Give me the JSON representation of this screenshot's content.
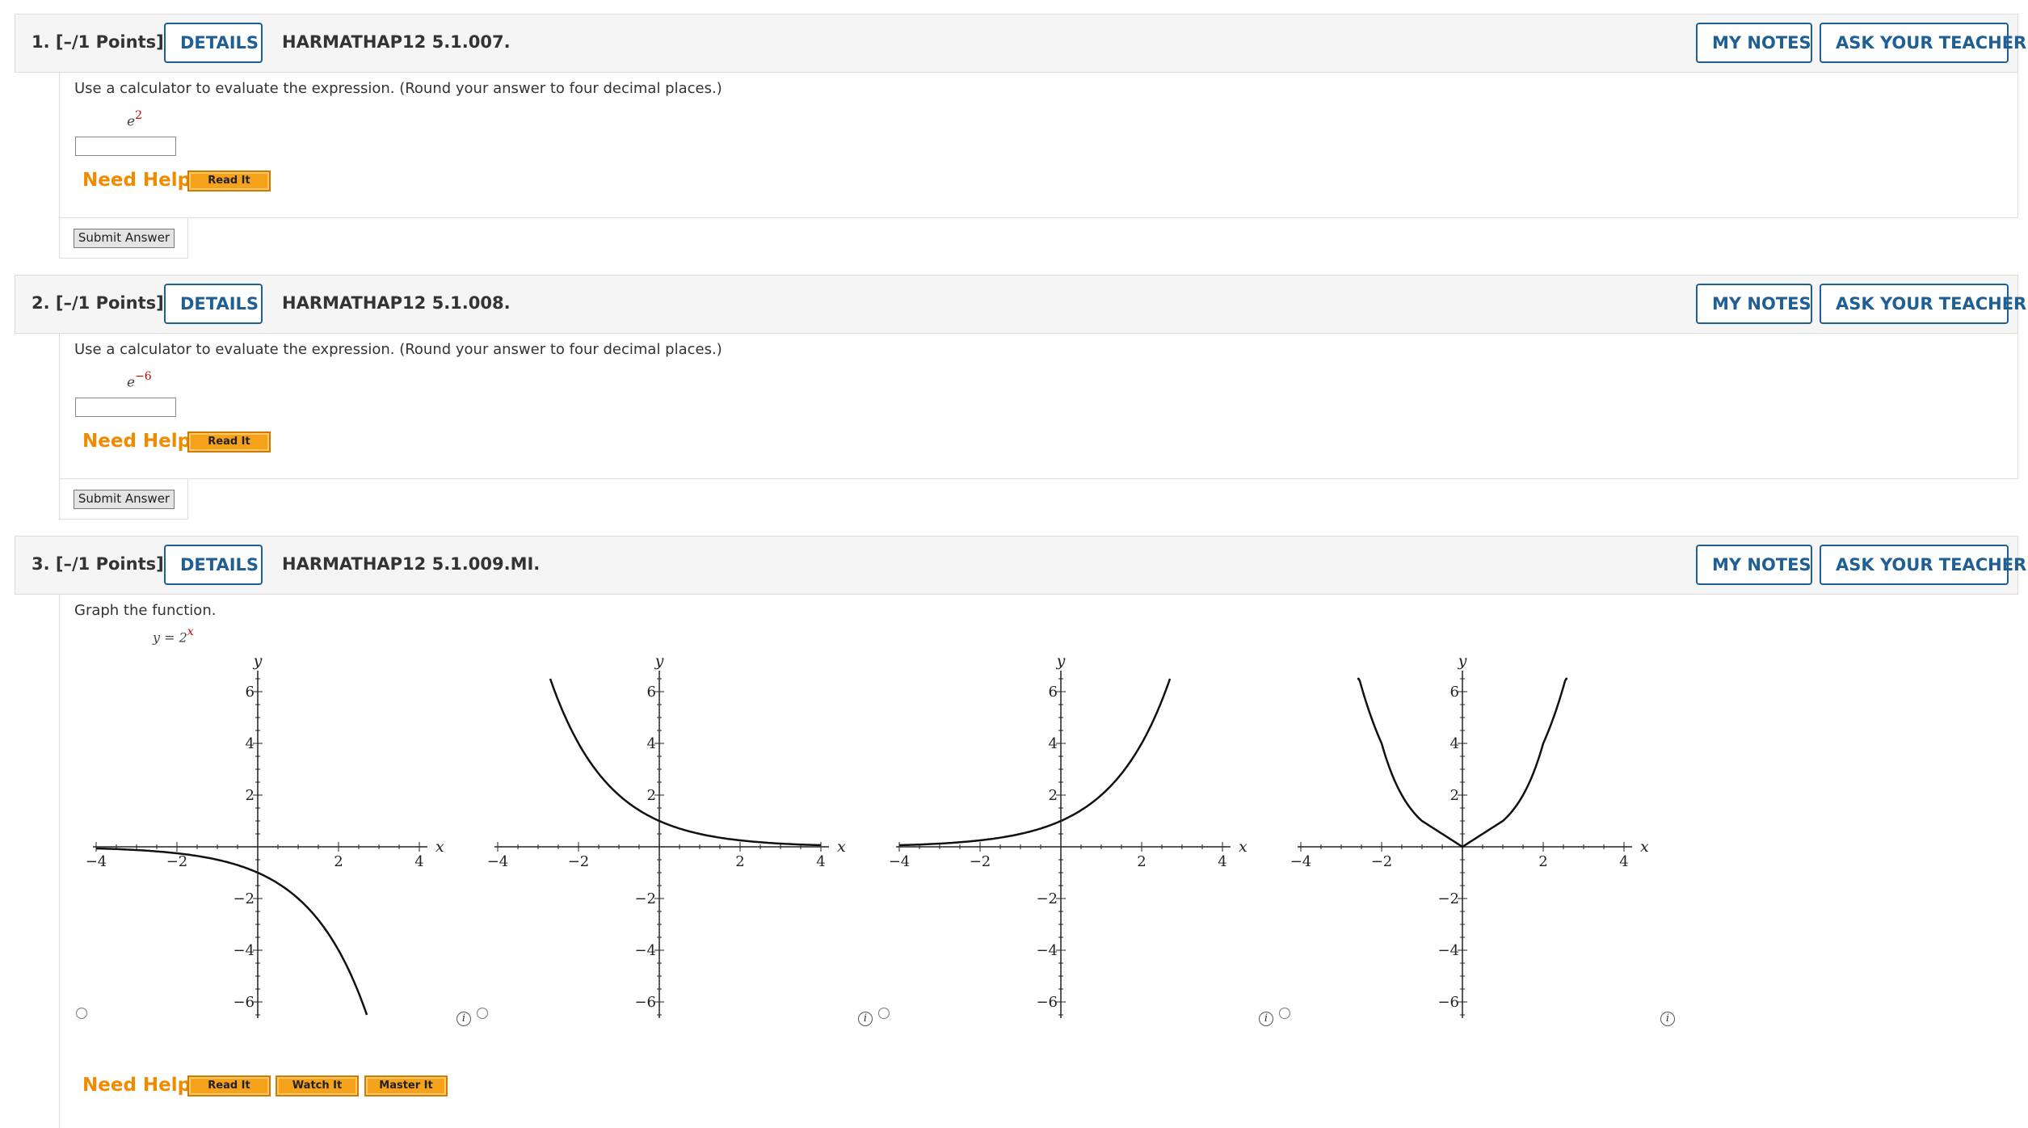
{
  "questions": [
    {
      "number": "1.",
      "points": "[–/1 Points]",
      "details_label": "DETAILS",
      "code": "HARMATHAP12 5.1.007.",
      "my_notes_label": "MY NOTES",
      "ask_teacher_label": "ASK YOUR TEACHER",
      "prompt": "Use a calculator to evaluate the expression. (Round your answer to four decimal places.)",
      "expr_base": "e",
      "expr_exp": "2",
      "answer_value": "",
      "need_help": "Need Help?",
      "read_it": "Read It",
      "submit": "Submit Answer"
    },
    {
      "number": "2.",
      "points": "[–/1 Points]",
      "details_label": "DETAILS",
      "code": "HARMATHAP12 5.1.008.",
      "my_notes_label": "MY NOTES",
      "ask_teacher_label": "ASK YOUR TEACHER",
      "prompt": "Use a calculator to evaluate the expression. (Round your answer to four decimal places.)",
      "expr_base": "e",
      "expr_exp": "−6",
      "answer_value": "",
      "need_help": "Need Help?",
      "read_it": "Read It",
      "submit": "Submit Answer"
    },
    {
      "number": "3.",
      "points": "[–/1 Points]",
      "details_label": "DETAILS",
      "code": "HARMATHAP12 5.1.009.MI.",
      "my_notes_label": "MY NOTES",
      "ask_teacher_label": "ASK YOUR TEACHER",
      "prompt": "Graph the function.",
      "expr_lhs": "y = 2",
      "expr_exp": "x",
      "need_help": "Need Help?",
      "read_it": "Read It",
      "watch_it": "Watch It",
      "master_it": "Master It"
    }
  ],
  "chart_data": [
    {
      "type": "line",
      "option": 1,
      "function_shown": "y = -2^x",
      "x": [
        -4,
        -3,
        -2,
        -1,
        0,
        1,
        2,
        2.7
      ],
      "y": [
        -0.0625,
        -0.125,
        -0.25,
        -0.5,
        -1,
        -2,
        -4,
        -6.5
      ],
      "xlabel": "x",
      "ylabel": "y",
      "xlim": [
        -4,
        4
      ],
      "ylim": [
        -6.5,
        6.5
      ],
      "xticks": [
        -4,
        -2,
        2,
        4
      ],
      "yticks": [
        -6,
        -4,
        -2,
        2,
        4,
        6
      ],
      "selected": false
    },
    {
      "type": "line",
      "option": 2,
      "function_shown": "y = 2^-x",
      "x": [
        -2.7,
        -2,
        -1,
        0,
        1,
        2,
        3,
        4
      ],
      "y": [
        6.5,
        4,
        2,
        1,
        0.5,
        0.25,
        0.125,
        0.0625
      ],
      "xlabel": "x",
      "ylabel": "y",
      "xlim": [
        -4,
        4
      ],
      "ylim": [
        -6.5,
        6.5
      ],
      "xticks": [
        -4,
        -2,
        2,
        4
      ],
      "yticks": [
        -6,
        -4,
        -2,
        2,
        4,
        6
      ],
      "selected": false
    },
    {
      "type": "line",
      "option": 3,
      "function_shown": "y = 2^x",
      "x": [
        -4,
        -3,
        -2,
        -1,
        0,
        1,
        2,
        2.7
      ],
      "y": [
        0.0625,
        0.125,
        0.25,
        0.5,
        1,
        2,
        4,
        6.5
      ],
      "xlabel": "x",
      "ylabel": "y",
      "xlim": [
        -4,
        4
      ],
      "ylim": [
        -6.5,
        6.5
      ],
      "xticks": [
        -4,
        -2,
        2,
        4
      ],
      "yticks": [
        -6,
        -4,
        -2,
        2,
        4,
        6
      ],
      "selected": false
    },
    {
      "type": "line",
      "option": 4,
      "function_shown": "y = x^2 (shape)",
      "x": [
        -2.6,
        -2,
        -1,
        0,
        1,
        2,
        2.6
      ],
      "y": [
        6.76,
        4,
        1,
        0,
        1,
        4,
        6.76
      ],
      "xlabel": "x",
      "ylabel": "y",
      "xlim": [
        -4,
        4
      ],
      "ylim": [
        -6.5,
        6.5
      ],
      "xticks": [
        -4,
        -2,
        2,
        4
      ],
      "yticks": [
        -6,
        -4,
        -2,
        2,
        4,
        6
      ],
      "selected": false
    }
  ],
  "icons": {
    "info": "info-icon",
    "radio": "radio-button"
  }
}
